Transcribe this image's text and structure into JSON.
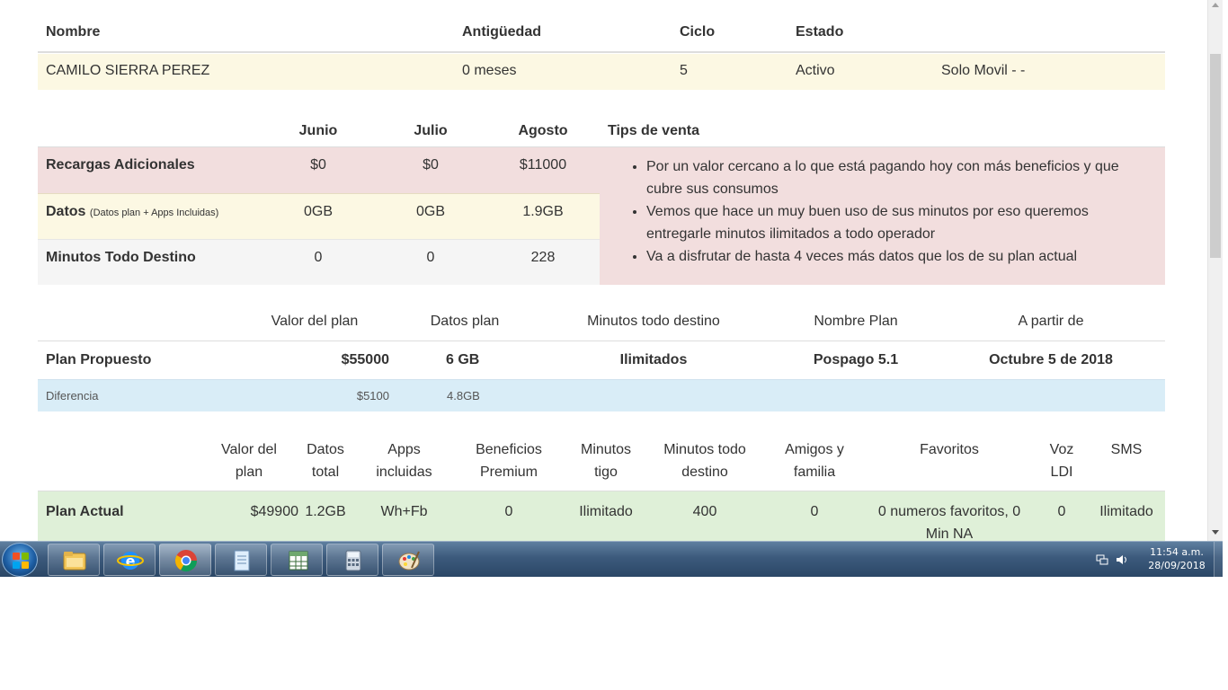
{
  "client_table": {
    "headers": [
      "Nombre",
      "Antigüedad",
      "Ciclo",
      "Estado"
    ],
    "row": {
      "nombre": "CAMILO SIERRA PEREZ",
      "antiguedad": "0 meses",
      "ciclo": "5",
      "estado": "Activo",
      "extra": "Solo Movil - -"
    }
  },
  "consumption_table": {
    "headers": [
      "Junio",
      "Julio",
      "Agosto",
      "Tips de venta"
    ],
    "rows": [
      {
        "label": "Recargas Adicionales",
        "note": "",
        "values": [
          "$0",
          "$0",
          "$11000"
        ]
      },
      {
        "label": "Datos",
        "note": "(Datos plan + Apps Incluidas)",
        "values": [
          "0GB",
          "0GB",
          "1.9GB"
        ]
      },
      {
        "label": "Minutos Todo Destino",
        "note": "",
        "values": [
          "0",
          "0",
          "228"
        ]
      }
    ],
    "tips": [
      "Por un valor cercano a lo que está pagando hoy con más beneficios y que cubre sus consumos",
      "Vemos que hace un muy buen uso de sus minutos por eso queremos entregarle minutos ilimitados a todo operador",
      "Va a disfrutar de hasta 4 veces más datos que los de su plan actual"
    ]
  },
  "proposed_table": {
    "headers": [
      "Valor del plan",
      "Datos plan",
      "Minutos todo destino",
      "Nombre Plan",
      "A partir de"
    ],
    "plan": {
      "label": "Plan Propuesto",
      "valor": "$55000",
      "datos": "6 GB",
      "minutos": "Ilimitados",
      "nombre": "Pospago 5.1",
      "desde": "Octubre 5 de 2018"
    },
    "diferencia": {
      "label": "Diferencia",
      "valor": "$5100",
      "datos": "4.8GB"
    }
  },
  "current_table": {
    "headers": [
      "Valor del plan",
      "Datos total",
      "Apps incluidas",
      "Beneficios Premium",
      "Minutos tigo",
      "Minutos todo destino",
      "Amigos y familia",
      "Favoritos",
      "Voz LDI",
      "SMS"
    ],
    "plan": {
      "label": "Plan Actual",
      "values": [
        "$49900",
        "1.2GB",
        "Wh+Fb",
        "0",
        "Ilimitado",
        "400",
        "0",
        "0 numeros favoritos, 0 Min NA",
        "0",
        "Ilimitado"
      ]
    }
  },
  "taskbar": {
    "apps": [
      "windows-explorer",
      "internet-explorer",
      "chrome",
      "notepad",
      "excel",
      "calculator",
      "paint"
    ],
    "time": "11:54 a.m.",
    "date": "28/09/2018"
  }
}
